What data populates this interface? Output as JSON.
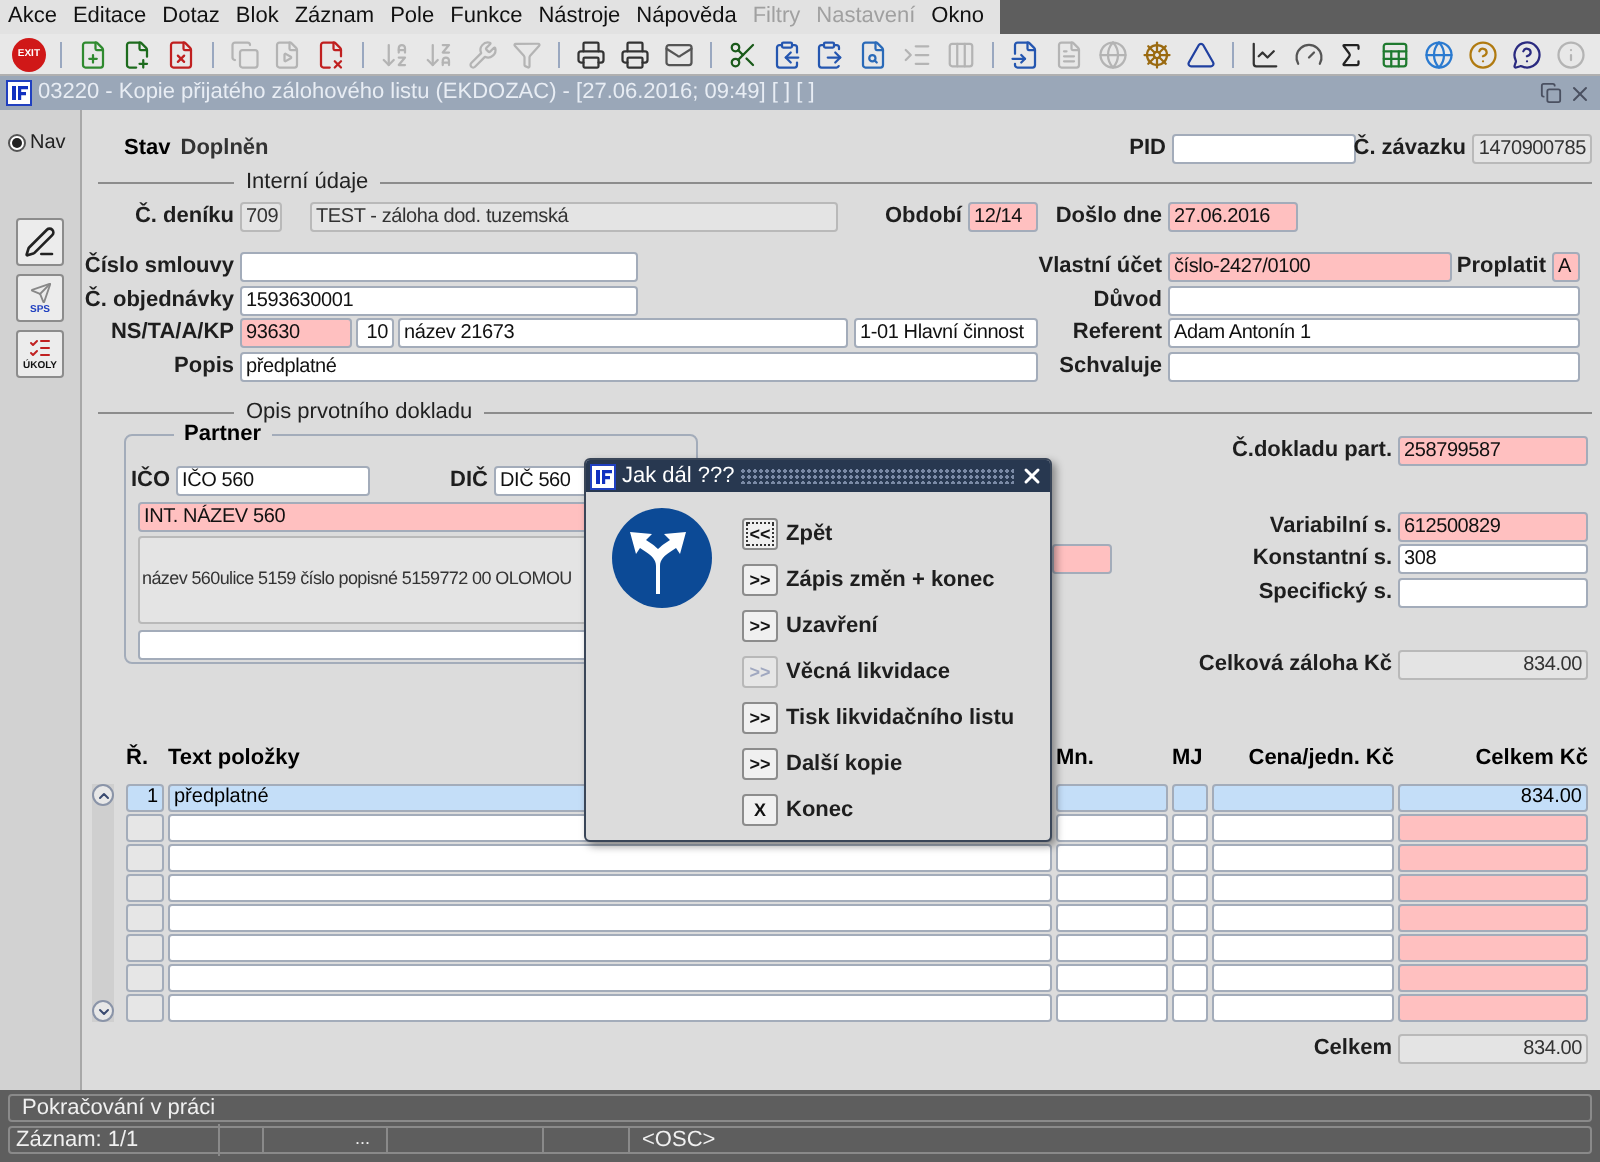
{
  "menu": [
    {
      "label": "Akce",
      "disabled": false
    },
    {
      "label": "Editace",
      "disabled": false
    },
    {
      "label": "Dotaz",
      "disabled": false
    },
    {
      "label": "Blok",
      "disabled": false
    },
    {
      "label": "Záznam",
      "disabled": false
    },
    {
      "label": "Pole",
      "disabled": false
    },
    {
      "label": "Funkce",
      "disabled": false
    },
    {
      "label": "Nástroje",
      "disabled": false
    },
    {
      "label": "Nápověda",
      "disabled": false
    },
    {
      "label": "Filtry",
      "disabled": true
    },
    {
      "label": "Nastavení",
      "disabled": true
    },
    {
      "label": "Okno",
      "disabled": false
    }
  ],
  "toolbar": [
    {
      "kind": "exit",
      "label": "EXIT",
      "disabled": false
    },
    {
      "kind": "separator"
    },
    {
      "kind": "button",
      "disabled": false
    },
    {
      "kind": "button",
      "disabled": false
    },
    {
      "kind": "button",
      "disabled": false
    },
    {
      "kind": "separator"
    },
    {
      "kind": "button",
      "disabled": true
    },
    {
      "kind": "button",
      "disabled": true
    },
    {
      "kind": "button",
      "disabled": false
    },
    {
      "kind": "separator"
    },
    {
      "kind": "button",
      "disabled": true
    },
    {
      "kind": "button",
      "disabled": true
    },
    {
      "kind": "button",
      "disabled": true
    },
    {
      "kind": "button",
      "disabled": true
    },
    {
      "kind": "separator"
    },
    {
      "kind": "button",
      "disabled": false
    },
    {
      "kind": "button",
      "disabled": false
    },
    {
      "kind": "button",
      "disabled": false
    },
    {
      "kind": "separator"
    },
    {
      "kind": "button",
      "disabled": false
    },
    {
      "kind": "button",
      "disabled": false
    },
    {
      "kind": "button",
      "disabled": false
    },
    {
      "kind": "button",
      "disabled": false
    },
    {
      "kind": "button",
      "disabled": true
    },
    {
      "kind": "button",
      "disabled": true
    },
    {
      "kind": "separator"
    },
    {
      "kind": "button",
      "disabled": false
    },
    {
      "kind": "button",
      "disabled": true
    },
    {
      "kind": "button",
      "disabled": true
    },
    {
      "kind": "button",
      "disabled": false
    },
    {
      "kind": "button",
      "disabled": false
    },
    {
      "kind": "separator"
    },
    {
      "kind": "button",
      "disabled": false
    },
    {
      "kind": "button",
      "disabled": false
    },
    {
      "kind": "button",
      "disabled": false
    },
    {
      "kind": "button",
      "disabled": false
    },
    {
      "kind": "button",
      "disabled": false
    },
    {
      "kind": "button",
      "disabled": false
    },
    {
      "kind": "button",
      "disabled": false
    },
    {
      "kind": "button",
      "disabled": true
    }
  ],
  "window": {
    "title": "03220 - Kopie přijatého zálohového listu (EKDOZAC) - [27.06.2016; 09:49] [ ] [ ]"
  },
  "nav": {
    "label": "Nav",
    "selected": true
  },
  "nav_buttons": [
    {
      "kind": "icon"
    },
    {
      "kind": "labeled",
      "label": "SPS"
    },
    {
      "kind": "labeled",
      "label": "ÚKOLY"
    }
  ],
  "header": {
    "stav": {
      "label": "Stav",
      "value": "Doplněn"
    },
    "pid": {
      "label": "PID",
      "required": false,
      "readonly": false
    },
    "zavazek": {
      "label": "Č. závazku",
      "value": "1470900785",
      "required": false,
      "readonly": true
    }
  },
  "interni": {
    "title": "Interní údaje",
    "denik": {
      "label": "Č. deníku",
      "code": {
        "value": "709",
        "required": false,
        "readonly": true
      },
      "name": {
        "value": "TEST - záloha dod. tuzemská",
        "required": false,
        "readonly": true
      }
    },
    "obdobi": {
      "label": "Období",
      "value": "12/14",
      "required": true,
      "readonly": false
    },
    "doslo": {
      "label": "Došlo dne",
      "value": "27.06.2016",
      "required": true,
      "readonly": false
    },
    "smlouva": {
      "label": "Číslo smlouvy",
      "required": false,
      "readonly": false
    },
    "ucet": {
      "label": "Vlastní účet",
      "value": "číslo-2427/0100",
      "required": true,
      "readonly": false
    },
    "proplatit": {
      "label": "Proplatit",
      "value": "A",
      "required": true,
      "readonly": false
    },
    "objednavka": {
      "label": "Č. objednávky",
      "value": "1593630001",
      "required": false,
      "readonly": false
    },
    "duvod": {
      "label": "Důvod",
      "required": false,
      "readonly": false
    },
    "ns": {
      "label": "NS/TA/A/KP",
      "parts": [
        {
          "value": "93630",
          "required": true,
          "readonly": false
        },
        {
          "value": "10",
          "required": false,
          "readonly": false
        },
        {
          "value": "název 21673",
          "required": false,
          "readonly": false
        },
        {
          "value": "1-01 Hlavní činnost",
          "required": false,
          "readonly": false
        }
      ]
    },
    "referent": {
      "label": "Referent",
      "value": "Adam Antonín 1",
      "required": false,
      "readonly": false
    },
    "popis": {
      "label": "Popis",
      "value": "předplatné",
      "required": false,
      "readonly": false
    },
    "schvaluje": {
      "label": "Schvaluje",
      "required": false,
      "readonly": false
    }
  },
  "opis": {
    "title": "Opis prvotního dokladu",
    "partner": {
      "title": "Partner",
      "ico": {
        "label": "IČO",
        "value": "IČO 560",
        "required": false,
        "readonly": false
      },
      "dic": {
        "label": "DIČ",
        "value": "DIČ 560",
        "required": false,
        "readonly": false
      },
      "nazev": {
        "value": "INT. NÁZEV 560",
        "required": true,
        "readonly": false
      },
      "adresa": {
        "value": "název 560ulice 5159 číslo popisné 5159772 00 OLOMOU",
        "required": false,
        "readonly": true
      },
      "dalsi": {
        "required": false,
        "readonly": false
      }
    },
    "doklad": {
      "label": "Č.dokladu part.",
      "value": "258799587",
      "required": true,
      "readonly": false
    },
    "variabilni": {
      "label": "Variabilní s.",
      "value": "612500829",
      "required": true,
      "readonly": false
    },
    "extra": {
      "required": true,
      "readonly": false
    },
    "konstantni": {
      "label": "Konstantní s.",
      "value": "308",
      "required": false,
      "readonly": false
    },
    "specificky": {
      "label": "Specifický s.",
      "required": false,
      "readonly": false
    },
    "zaloha": {
      "label": "Celková záloha Kč",
      "value": "834.00",
      "required": false,
      "readonly": true
    }
  },
  "table": {
    "columns": [
      "Ř.",
      "Text položky",
      "Mn.",
      "MJ",
      "Cena/jedn. Kč",
      "Celkem Kč"
    ],
    "rows": [
      {
        "selected": true,
        "number": "1",
        "text": "předplatné",
        "total": "834.00"
      },
      {
        "selected": false
      },
      {
        "selected": false
      },
      {
        "selected": false
      },
      {
        "selected": false
      },
      {
        "selected": false
      },
      {
        "selected": false
      },
      {
        "selected": false
      }
    ],
    "total": {
      "label": "Celkem",
      "value": "834.00"
    }
  },
  "dialog": {
    "title": "Jak dál ???",
    "options": [
      {
        "key": "<<",
        "label": "Zpět",
        "disabled": false,
        "focused": true
      },
      {
        "key": ">>",
        "label": "Zápis změn + konec",
        "disabled": false,
        "focused": false
      },
      {
        "key": ">>",
        "label": "Uzavření",
        "disabled": false,
        "focused": false
      },
      {
        "key": ">>",
        "label": "Věcná likvidace",
        "disabled": true,
        "focused": false
      },
      {
        "key": ">>",
        "label": "Tisk likvidačního listu",
        "disabled": false,
        "focused": false
      },
      {
        "key": ">>",
        "label": "Další kopie",
        "disabled": false,
        "focused": false
      },
      {
        "key": "X",
        "label": "Konec",
        "disabled": false,
        "focused": false
      }
    ]
  },
  "status": {
    "message": "Pokračování v práci",
    "record": "Záznam: 1/1",
    "cell_3": "...",
    "mode": "<OSC>"
  }
}
